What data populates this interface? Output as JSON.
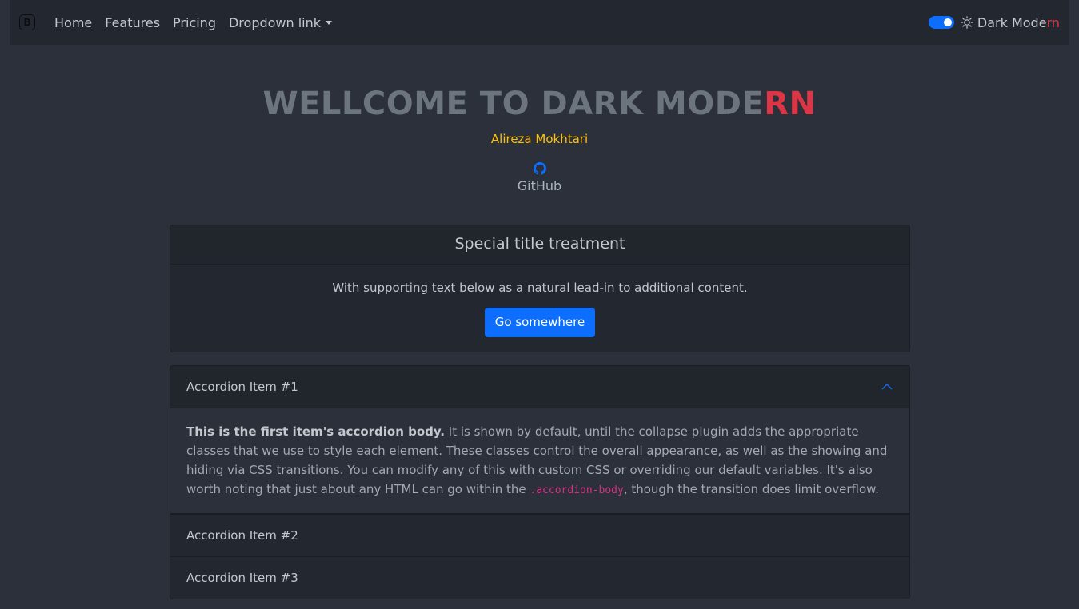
{
  "navbar": {
    "brand_glyph": "B",
    "links": [
      "Home",
      "Features",
      "Pricing"
    ],
    "dropdown_label": "Dropdown link",
    "theme_label_main": "Dark Mode",
    "theme_label_accent": "rn",
    "toggle_on": true,
    "toggle_icon": "sun-icon"
  },
  "hero": {
    "title_main": "WELLCOME TO DARK MODE",
    "title_accent": "RN",
    "author": "Alireza Mokhtari",
    "github_icon": "github-icon",
    "github_label": "GitHub"
  },
  "card": {
    "header": "Special title treatment",
    "text": "With supporting text below as a natural lead-in to additional content.",
    "button": "Go somewhere"
  },
  "accordion": {
    "items": [
      {
        "title": "Accordion Item #1",
        "expanded": true,
        "body_bold": "This is the first item's accordion body.",
        "body_text": " It is shown by default, until the collapse plugin adds the appropriate classes that we use to style each element. These classes control the overall appearance, as well as the showing and hiding via CSS transitions. You can modify any of this with custom CSS or overriding our default variables. It's also worth noting that just about any HTML can go within the ",
        "body_code": ".accordion-body",
        "body_tail": ", though the transition does limit overflow."
      },
      {
        "title": "Accordion Item #2",
        "expanded": false
      },
      {
        "title": "Accordion Item #3",
        "expanded": false
      }
    ]
  },
  "colors": {
    "accent_red": "#dc3545",
    "author_yellow": "#ffc107",
    "primary_blue": "#0d6efd",
    "code_pink": "#d63384"
  }
}
